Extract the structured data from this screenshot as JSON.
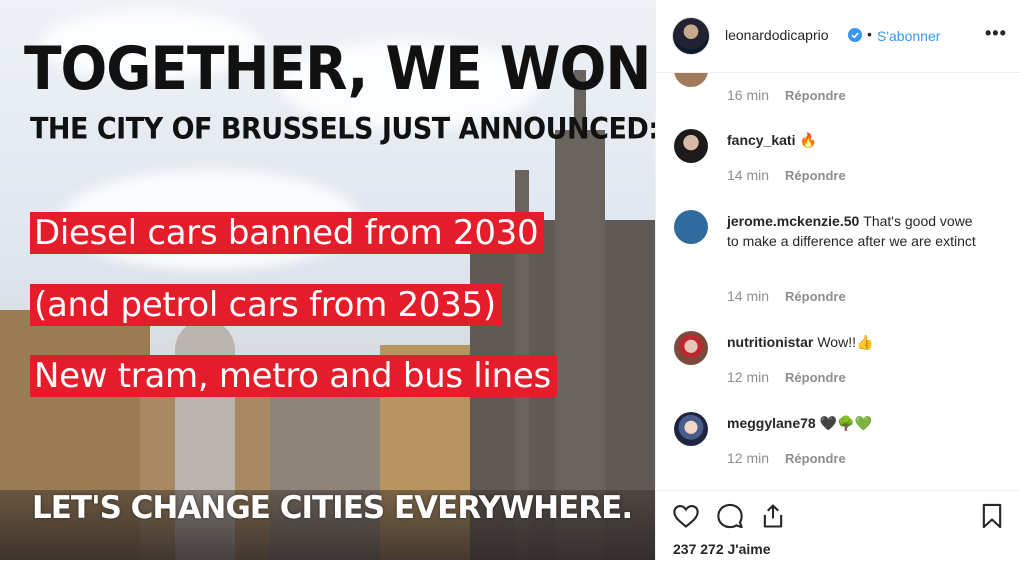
{
  "post": {
    "headline": "TOGETHER, WE WON!",
    "subheadline": "THE CITY OF BRUSSELS JUST ANNOUNCED:",
    "points": [
      "Diesel cars banned from 2030",
      "(and petrol cars from 2035)",
      "New tram, metro and bus lines"
    ],
    "footer": "LET'S CHANGE CITIES EVERYWHERE.",
    "highlight_color": "#e51d2b"
  },
  "header": {
    "username": "leonardodicaprio",
    "separator": "•",
    "follow_label": "S'abonner",
    "more_label": "•••"
  },
  "comments": [
    {
      "username": "",
      "text": "",
      "time": "16 min",
      "reply": "Répondre"
    },
    {
      "username": "fancy_kati",
      "text": "🔥",
      "time": "14 min",
      "reply": "Répondre"
    },
    {
      "username": "jerome.mckenzie.50",
      "text": "That's good vowe to make a difference after we are extinct",
      "time": "14 min",
      "reply": "Répondre"
    },
    {
      "username": "nutritionistar",
      "text": "Wow!!👍",
      "time": "12 min",
      "reply": "Répondre"
    },
    {
      "username": "meggylane78",
      "text": "🖤🌳💚",
      "time": "12 min",
      "reply": "Répondre"
    }
  ],
  "likes": "237 272 J'aime",
  "colors": {
    "link": "#3897f0",
    "muted": "#8e8e8e",
    "text": "#262626"
  },
  "icons": [
    "heart-icon",
    "comment-icon",
    "share-icon",
    "bookmark-icon",
    "verified-icon"
  ]
}
